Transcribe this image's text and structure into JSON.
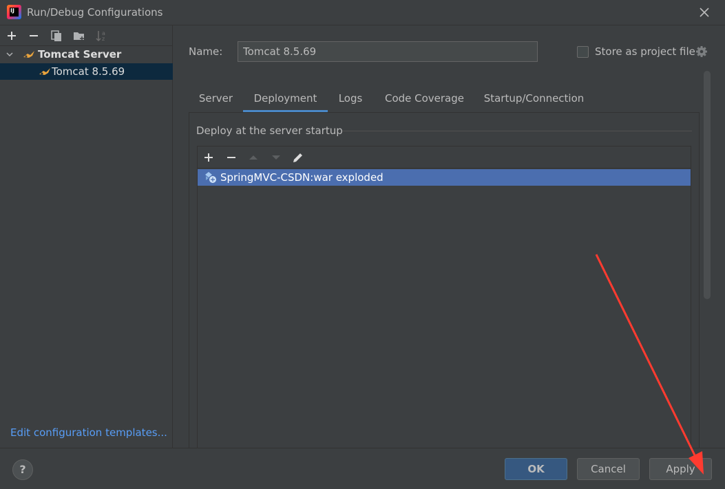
{
  "window": {
    "title": "Run/Debug Configurations",
    "app_icon_text": "IJ"
  },
  "sidebar": {
    "toolbar": [
      "add-icon",
      "remove-icon",
      "copy-icon",
      "folder-icon",
      "sort-icon"
    ],
    "tree": {
      "group_label": "Tomcat Server",
      "child_label": "Tomcat 8.5.69"
    },
    "edit_templates_link": "Edit configuration templates..."
  },
  "main": {
    "name_label": "Name:",
    "name_value": "Tomcat 8.5.69",
    "store_as_project_file_label": "Store as project file",
    "store_as_project_file_checked": false,
    "tabs": [
      {
        "label": "Server"
      },
      {
        "label": "Deployment",
        "active": true
      },
      {
        "label": "Logs"
      },
      {
        "label": "Code Coverage"
      },
      {
        "label": "Startup/Connection"
      }
    ],
    "deployment": {
      "section_label": "Deploy at the server startup",
      "toolbar": [
        "add-icon",
        "remove-icon",
        "move-up-icon",
        "move-down-icon",
        "edit-icon"
      ],
      "items": [
        {
          "label": "SpringMVC-CSDN:war exploded",
          "selected": true
        }
      ]
    }
  },
  "footer": {
    "help_label": "?",
    "ok_label": "OK",
    "cancel_label": "Cancel",
    "apply_label": "Apply"
  },
  "colors": {
    "background": "#3c3f41",
    "selection": "#4b6eaf",
    "tree_selection": "#0d293e",
    "link": "#589df6",
    "ok_button": "#365880",
    "annotation_arrow": "#ff3b30"
  }
}
